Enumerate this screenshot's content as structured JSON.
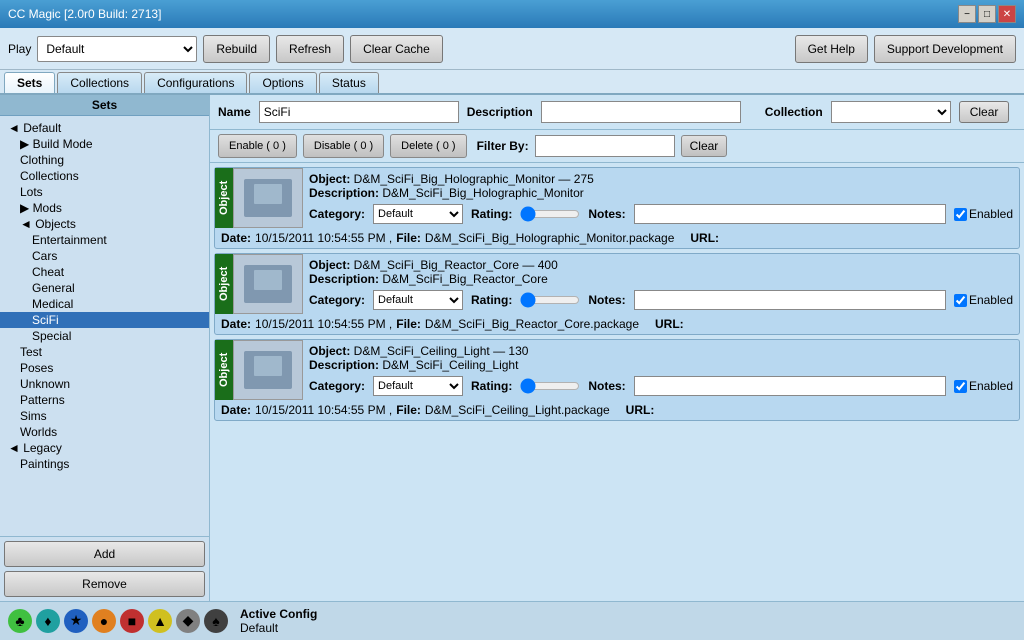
{
  "titlebar": {
    "title": "CC Magic [2.0r0 Build: 2713]",
    "min": "−",
    "max": "□",
    "close": "✕"
  },
  "toolbar": {
    "play_label": "Play",
    "play_default": "Default",
    "rebuild_label": "Rebuild",
    "refresh_label": "Refresh",
    "clear_cache_label": "Clear Cache",
    "get_help_label": "Get Help",
    "support_label": "Support Development"
  },
  "tabs": [
    {
      "id": "sets",
      "label": "Sets",
      "active": true
    },
    {
      "id": "collections",
      "label": "Collections",
      "active": false
    },
    {
      "id": "configurations",
      "label": "Configurations",
      "active": false
    },
    {
      "id": "options",
      "label": "Options",
      "active": false
    },
    {
      "id": "status",
      "label": "Status",
      "active": false
    }
  ],
  "sidebar": {
    "header": "Sets",
    "tree": [
      {
        "id": "default",
        "label": "◄ Default",
        "indent": "indent1",
        "expanded": true
      },
      {
        "id": "build-mode",
        "label": "▶ Build Mode",
        "indent": "indent2"
      },
      {
        "id": "clothing",
        "label": "Clothing",
        "indent": "indent2"
      },
      {
        "id": "collections",
        "label": "Collections",
        "indent": "indent2"
      },
      {
        "id": "lots",
        "label": "Lots",
        "indent": "indent2"
      },
      {
        "id": "mods",
        "label": "▶ Mods",
        "indent": "indent2"
      },
      {
        "id": "objects",
        "label": "◄ Objects",
        "indent": "indent2",
        "expanded": true
      },
      {
        "id": "entertainment",
        "label": "Entertainment",
        "indent": "indent3"
      },
      {
        "id": "cars",
        "label": "Cars",
        "indent": "indent3"
      },
      {
        "id": "cheat",
        "label": "Cheat",
        "indent": "indent3"
      },
      {
        "id": "general",
        "label": "General",
        "indent": "indent3"
      },
      {
        "id": "medical",
        "label": "Medical",
        "indent": "indent3"
      },
      {
        "id": "scifi",
        "label": "SciFi",
        "indent": "indent3",
        "selected": true
      },
      {
        "id": "special",
        "label": "Special",
        "indent": "indent3"
      },
      {
        "id": "test",
        "label": "Test",
        "indent": "indent2"
      },
      {
        "id": "poses",
        "label": "Poses",
        "indent": "indent2"
      },
      {
        "id": "unknown",
        "label": "Unknown",
        "indent": "indent2"
      },
      {
        "id": "patterns",
        "label": "Patterns",
        "indent": "indent2"
      },
      {
        "id": "sims",
        "label": "Sims",
        "indent": "indent2"
      },
      {
        "id": "worlds",
        "label": "Worlds",
        "indent": "indent2"
      },
      {
        "id": "legacy",
        "label": "◄ Legacy",
        "indent": "indent1",
        "expanded": true
      },
      {
        "id": "paintings",
        "label": "Paintings",
        "indent": "indent2"
      }
    ],
    "add_label": "Add",
    "remove_label": "Remove"
  },
  "content": {
    "name_label": "Name",
    "name_value": "SciFi",
    "description_label": "Description",
    "description_value": "",
    "collection_label": "Collection",
    "collection_value": "",
    "clear_label": "Clear",
    "action_buttons": {
      "enable": "Enable ( 0 )",
      "disable": "Disable ( 0 )",
      "delete": "Delete ( 0 )"
    },
    "filter_label": "Filter By:",
    "filter_value": "",
    "clear_filter": "Clear",
    "items": [
      {
        "id": "item1",
        "tag": "Object",
        "object_name": "D&M_SciFi_Big_Holographic_Monitor",
        "object_id": "275",
        "description": "D&M_SciFi_Big_Holographic_Monitor",
        "category": "Default",
        "enabled": true,
        "date": "10/15/2011 10:54:55 PM",
        "file": "D&M_SciFi_Big_Holographic_Monitor.package",
        "url": ""
      },
      {
        "id": "item2",
        "tag": "Object",
        "object_name": "D&M_SciFi_Big_Reactor_Core",
        "object_id": "400",
        "description": "D&M_SciFi_Big_Reactor_Core",
        "category": "Default",
        "enabled": true,
        "date": "10/15/2011 10:54:55 PM",
        "file": "D&M_SciFi_Big_Reactor_Core.package",
        "url": ""
      },
      {
        "id": "item3",
        "tag": "Object",
        "object_name": "D&M_SciFi_Ceiling_Light",
        "object_id": "130",
        "description": "D&M_SciFi_Ceiling_Light",
        "category": "Default",
        "enabled": true,
        "date": "10/15/2011 10:54:55 PM",
        "file": "D&M_SciFi_Ceiling_Light.package",
        "url": ""
      }
    ]
  },
  "statusbar": {
    "icons": [
      {
        "id": "icon1",
        "color": "icon-green",
        "symbol": "♣"
      },
      {
        "id": "icon2",
        "color": "icon-teal",
        "symbol": "♦"
      },
      {
        "id": "icon3",
        "color": "icon-blue",
        "symbol": "★"
      },
      {
        "id": "icon4",
        "color": "icon-orange",
        "symbol": "●"
      },
      {
        "id": "icon5",
        "color": "icon-red",
        "symbol": "■"
      },
      {
        "id": "icon6",
        "color": "icon-yellow",
        "symbol": "▲"
      },
      {
        "id": "icon7",
        "color": "icon-gray",
        "symbol": "◆"
      },
      {
        "id": "icon8",
        "color": "icon-dark",
        "symbol": "♠"
      }
    ],
    "active_config_label": "Active Config",
    "active_config_value": "Default"
  }
}
